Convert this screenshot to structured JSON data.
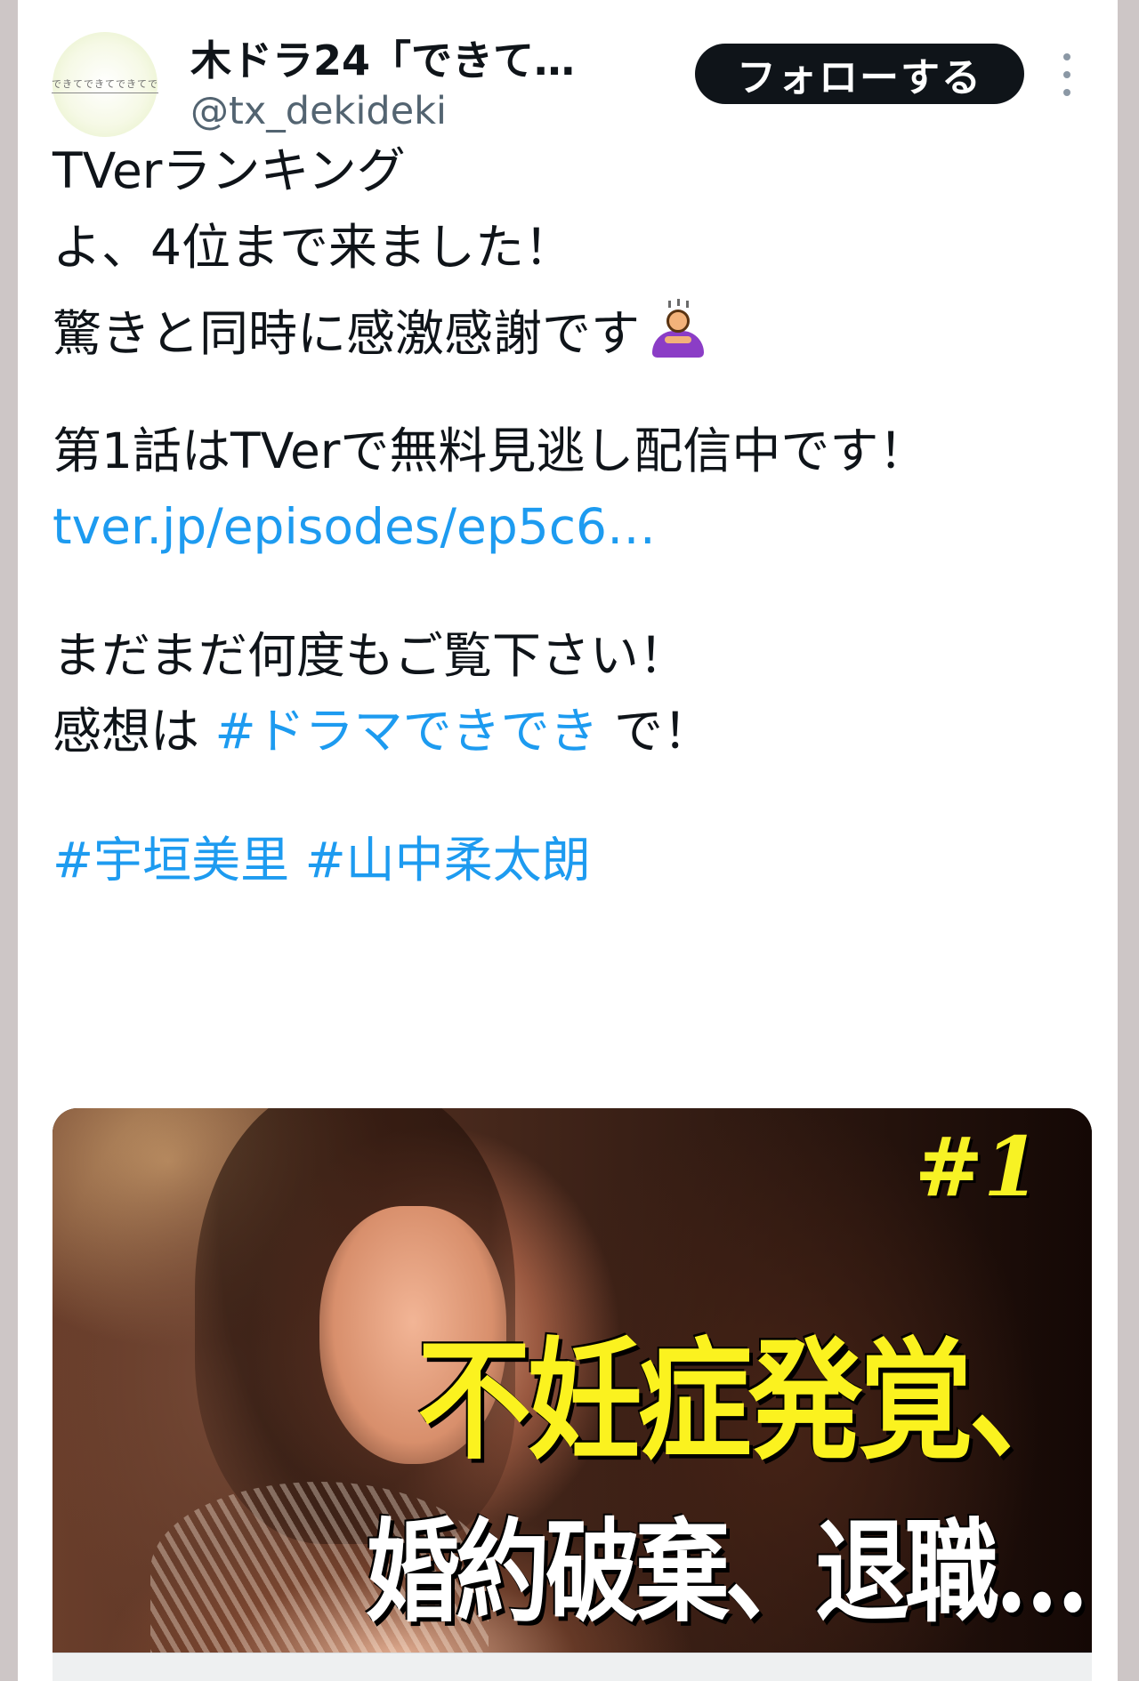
{
  "account": {
    "display_name": "木ドラ24「できて…",
    "handle": "@tx_dekideki",
    "avatar_text": "できてできてできてで",
    "follow_label": "フォローする"
  },
  "tweet": {
    "lines": [
      "TVerランキング",
      "よ、4位まで来ました！",
      "驚きと同時に感激感謝です",
      "第1話はTVerで無料見逃し配信中です！",
      "tver.jp/episodes/ep5c6…",
      "まだまだ何度もご覧下さい！",
      "感想は ",
      "#ドラマできでき",
      " で！",
      "#宇垣美里",
      "#山中柔太朗"
    ],
    "link_color": "#1d9bf0"
  },
  "media": {
    "episode_badge": "#1",
    "headline_line1": "不妊症発覚、",
    "headline_line2": "婚約破棄、退職…"
  }
}
